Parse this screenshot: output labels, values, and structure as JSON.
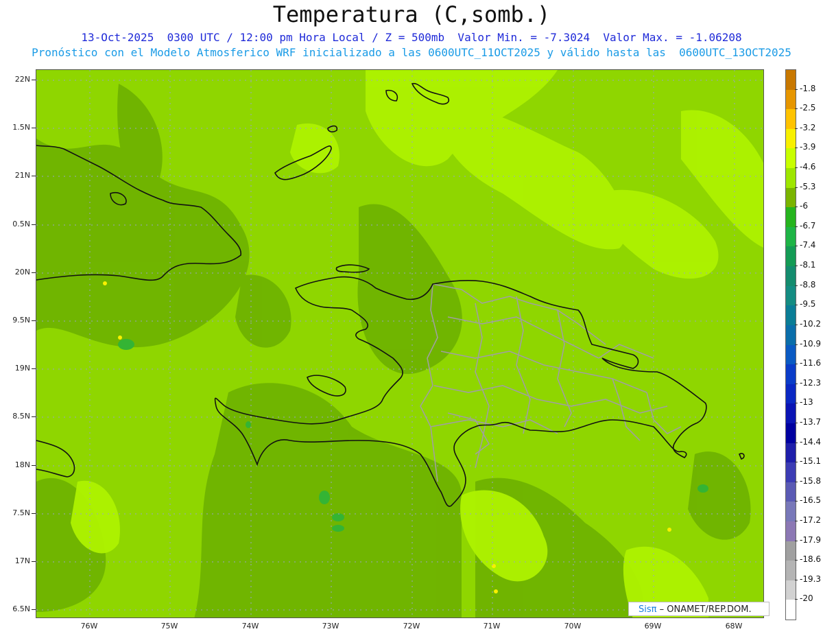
{
  "header": {
    "title": "Temperatura (C,somb.)",
    "line1": "13-Oct-2025  0300 UTC / 12:00 pm Hora Local / Z = 500mb  Valor Min. = -7.3024  Valor Max. = -1.06208",
    "line2": "Pronóstico con el Modelo Atmosferico WRF inicializado a las 0600UTC_11OCT2025 y válido hasta las  0600UTC_13OCT2025"
  },
  "map": {
    "lat_labels": [
      "22N",
      "1.5N",
      "21N",
      "0.5N",
      "20N",
      "9.5N",
      "19N",
      "8.5N",
      "18N",
      "7.5N",
      "17N",
      "6.5N"
    ],
    "lon_labels": [
      "76W",
      "75W",
      "74W",
      "73W",
      "72W",
      "71W",
      "70W",
      "69W",
      "68W"
    ],
    "colors": {
      "base": "#8fd600",
      "dark": "#6fb300",
      "light": "#aef200",
      "green": "#34b434",
      "coast": "#111111",
      "province": "#a0a0a0"
    }
  },
  "credit": {
    "sis": "Sisπ",
    "rest": " – ONAMET/REP.DOM."
  },
  "colorbar": {
    "labels": [
      "-1.8",
      "-2.5",
      "-3.2",
      "-3.9",
      "-4.6",
      "-5.3",
      "-6",
      "-6.7",
      "-7.4",
      "-8.1",
      "-8.8",
      "-9.5",
      "-10.2",
      "-10.9",
      "-11.6",
      "-12.3",
      "-13",
      "-13.7",
      "-14.4",
      "-15.1",
      "-15.8",
      "-16.5",
      "-17.2",
      "-17.9",
      "-18.6",
      "-19.3",
      "-20"
    ],
    "colors": [
      "#c87800",
      "#e69600",
      "#ffc300",
      "#f8f000",
      "#c8ff00",
      "#9ee600",
      "#7ab400",
      "#26b41e",
      "#1eb446",
      "#149b55",
      "#148c6e",
      "#148c82",
      "#0a7d96",
      "#0a6eaa",
      "#0a5ac3",
      "#0a3cc8",
      "#0a28c3",
      "#0a14b4",
      "#0000a0",
      "#1e1eaa",
      "#3c3cb4",
      "#5a5ab4",
      "#7878b9",
      "#8c78b4",
      "#a0a0a0",
      "#b4b4b4",
      "#d2d2d2",
      "#ffffff"
    ]
  }
}
